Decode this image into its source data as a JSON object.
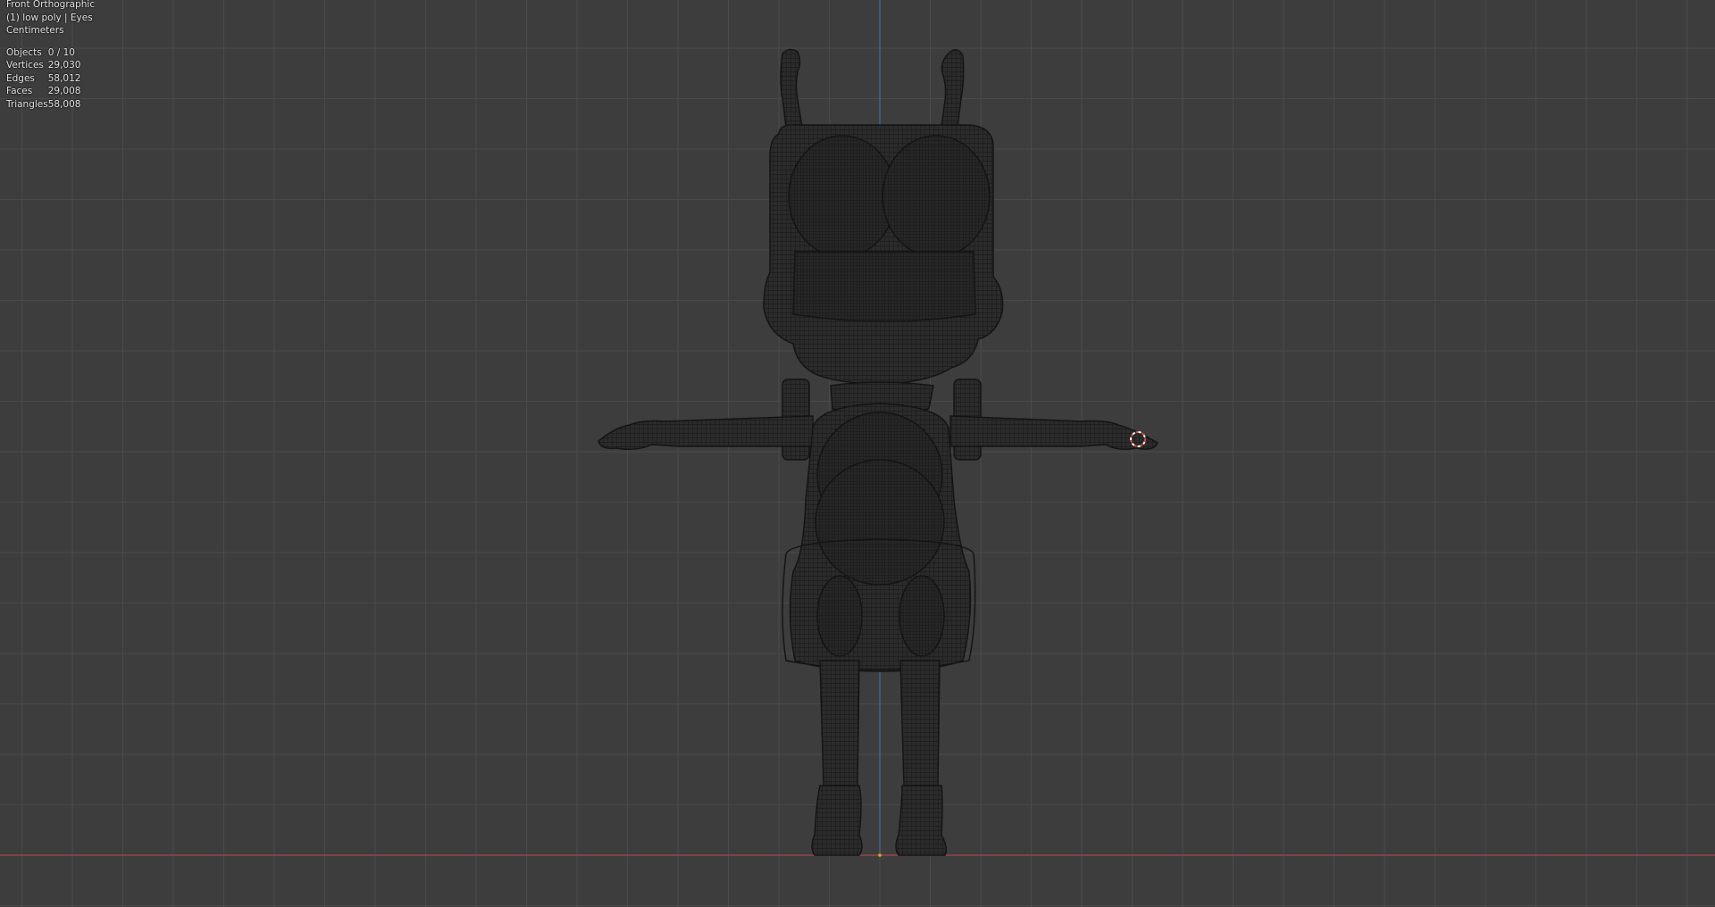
{
  "viewport": {
    "view_name": "Front Orthographic",
    "collection_info": "(1) low poly | Eyes",
    "units": "Centimeters"
  },
  "stats": {
    "objects": {
      "label": "Objects",
      "value": "0 / 10"
    },
    "vertices": {
      "label": "Vertices",
      "value": "29,030"
    },
    "edges": {
      "label": "Edges",
      "value": "58,012"
    },
    "faces": {
      "label": "Faces",
      "value": "29,008"
    },
    "triangles": {
      "label": "Triangles",
      "value": "58,008"
    }
  },
  "colors": {
    "background": "#3d3d3d",
    "grid_line": "#4a4a4a",
    "x_axis": "#a8454c",
    "z_axis": "#4a6a9e",
    "wireframe": "#111111",
    "cursor_ring": "#d44a3a"
  },
  "icons": {
    "cursor": "3d-cursor-icon",
    "origin": "world-origin-dot"
  }
}
